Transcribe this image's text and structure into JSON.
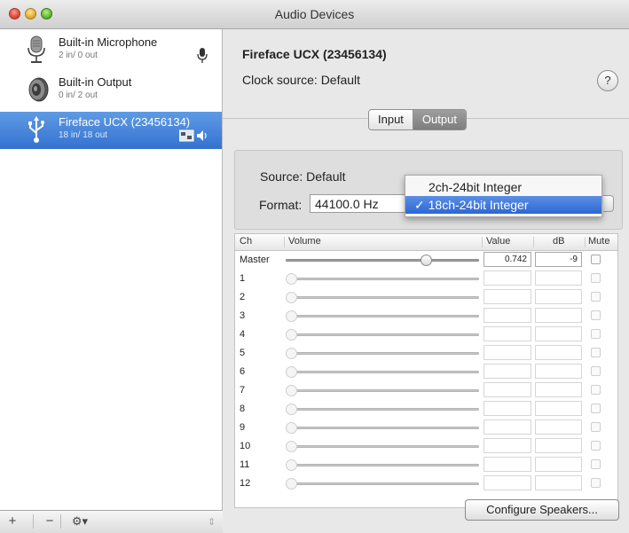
{
  "window": {
    "title": "Audio Devices"
  },
  "sidebar": {
    "devices": [
      {
        "name": "Built-in Microphone",
        "io": "2 in/ 0 out",
        "icon": "microphone-icon",
        "selected": false
      },
      {
        "name": "Built-in Output",
        "io": "0 in/ 2 out",
        "icon": "speaker-icon",
        "selected": false
      },
      {
        "name": "Fireface UCX (23456134)",
        "io": "18 in/ 18 out",
        "icon": "usb-icon",
        "selected": true
      }
    ],
    "footer": {
      "add": "+",
      "remove": "−",
      "gear": "⚙▾"
    }
  },
  "main": {
    "device_title": "Fireface UCX (23456134)",
    "clock_source": "Clock source: Default",
    "help": "?",
    "tabs": {
      "input": "Input",
      "output": "Output",
      "selected": "Output"
    },
    "source": "Source: Default",
    "format_label": "Format:",
    "sample_rate": "44100.0 Hz",
    "format_menu": {
      "options": [
        "2ch-24bit Integer",
        "✓ 18ch-24bit Integer"
      ],
      "selected_index": 1
    },
    "table": {
      "headers": {
        "ch": "Ch",
        "volume": "Volume",
        "value": "Value",
        "db": "dB",
        "mute": "Mute"
      },
      "rows": [
        {
          "ch": "Master",
          "value": "0.742",
          "db": "-9",
          "level": 0.742,
          "enabled": true
        },
        {
          "ch": "1",
          "value": "",
          "db": "",
          "level": 0,
          "enabled": false
        },
        {
          "ch": "2",
          "value": "",
          "db": "",
          "level": 0,
          "enabled": false
        },
        {
          "ch": "3",
          "value": "",
          "db": "",
          "level": 0,
          "enabled": false
        },
        {
          "ch": "4",
          "value": "",
          "db": "",
          "level": 0,
          "enabled": false
        },
        {
          "ch": "5",
          "value": "",
          "db": "",
          "level": 0,
          "enabled": false
        },
        {
          "ch": "6",
          "value": "",
          "db": "",
          "level": 0,
          "enabled": false
        },
        {
          "ch": "7",
          "value": "",
          "db": "",
          "level": 0,
          "enabled": false
        },
        {
          "ch": "8",
          "value": "",
          "db": "",
          "level": 0,
          "enabled": false
        },
        {
          "ch": "9",
          "value": "",
          "db": "",
          "level": 0,
          "enabled": false
        },
        {
          "ch": "10",
          "value": "",
          "db": "",
          "level": 0,
          "enabled": false
        },
        {
          "ch": "11",
          "value": "",
          "db": "",
          "level": 0,
          "enabled": false
        },
        {
          "ch": "12",
          "value": "",
          "db": "",
          "level": 0,
          "enabled": false
        }
      ]
    },
    "configure_speakers": "Configure Speakers..."
  },
  "colors": {
    "selection": "#3a78d4",
    "menu_highlight": "#2d67d6",
    "window_bg": "#e8e8e8"
  }
}
